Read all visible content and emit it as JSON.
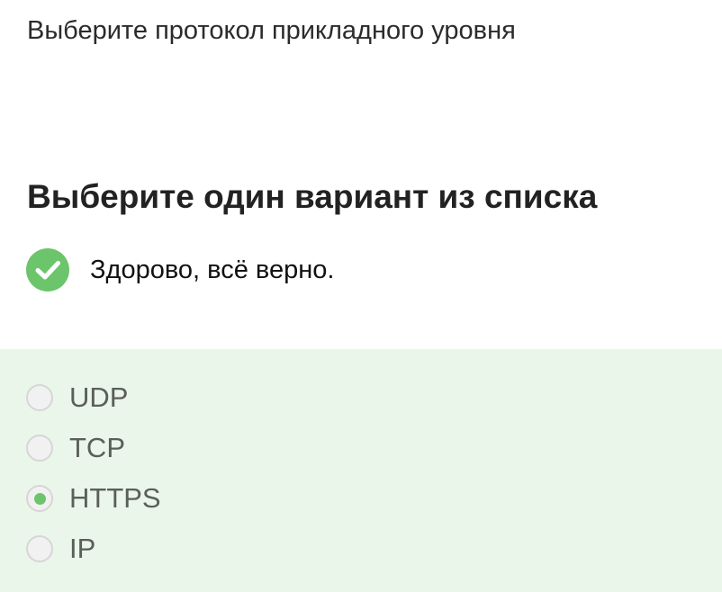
{
  "question": {
    "text": "Выберите протокол прикладного уровня"
  },
  "instruction": {
    "text": "Выберите один вариант из списка"
  },
  "feedback": {
    "icon": "check-circle-icon",
    "color": "#6cc46b",
    "text": "Здорово, всё верно."
  },
  "options_panel": {
    "background": "#ebf6ea",
    "options": [
      {
        "label": "UDP",
        "selected": false
      },
      {
        "label": "TCP",
        "selected": false
      },
      {
        "label": "HTTPS",
        "selected": true
      },
      {
        "label": "IP",
        "selected": false
      }
    ]
  }
}
